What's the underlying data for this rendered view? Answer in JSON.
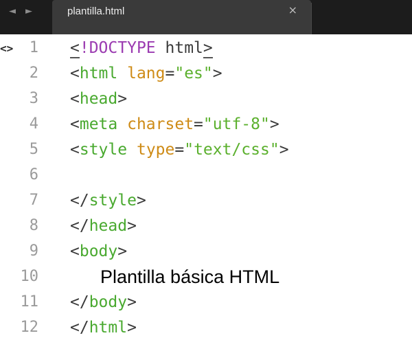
{
  "tab": {
    "title": "plantilla.html",
    "back_icon": "◄",
    "forward_icon": "►"
  },
  "gutter": {
    "marker": "<>"
  },
  "line_numbers": [
    "1",
    "2",
    "3",
    "4",
    "5",
    "6",
    "7",
    "8",
    "9",
    "10",
    "11",
    "12"
  ],
  "code": {
    "l1": {
      "lt": "<",
      "bang": "!DOCTYPE",
      "sp": " ",
      "kw": "html",
      "gt": ">"
    },
    "l2": {
      "lt": "<",
      "tag": "html",
      "sp": " ",
      "attr": "lang",
      "eq": "=",
      "val": "\"es\"",
      "gt": ">"
    },
    "l3": {
      "lt": "<",
      "tag": "head",
      "gt": ">"
    },
    "l4": {
      "lt": "<",
      "tag": "meta",
      "sp": " ",
      "attr": "charset",
      "eq": "=",
      "val": "\"utf-8\"",
      "gt": ">"
    },
    "l5": {
      "lt": "<",
      "tag": "style",
      "sp": " ",
      "attr": "type",
      "eq": "=",
      "val": "\"text/css\"",
      "gt": ">"
    },
    "l7": {
      "lt": "</",
      "tag": "style",
      "gt": ">"
    },
    "l8": {
      "lt": "</",
      "tag": "head",
      "gt": ">"
    },
    "l9": {
      "lt": "<",
      "tag": "body",
      "gt": ">"
    },
    "l10": {
      "text": "Plantilla básica HTML"
    },
    "l11": {
      "lt": "</",
      "tag": "body",
      "gt": ">"
    },
    "l12": {
      "lt": "</",
      "tag": "html",
      "gt": ">"
    }
  },
  "colors": {
    "tabbar": "#1c1c1c",
    "tab": "#3a3a3a",
    "doctype": "#9b3bb1",
    "tag": "#49a92f",
    "attribute": "#ce8b16",
    "string": "#5bb02d",
    "line_number": "#9a9a9a"
  }
}
